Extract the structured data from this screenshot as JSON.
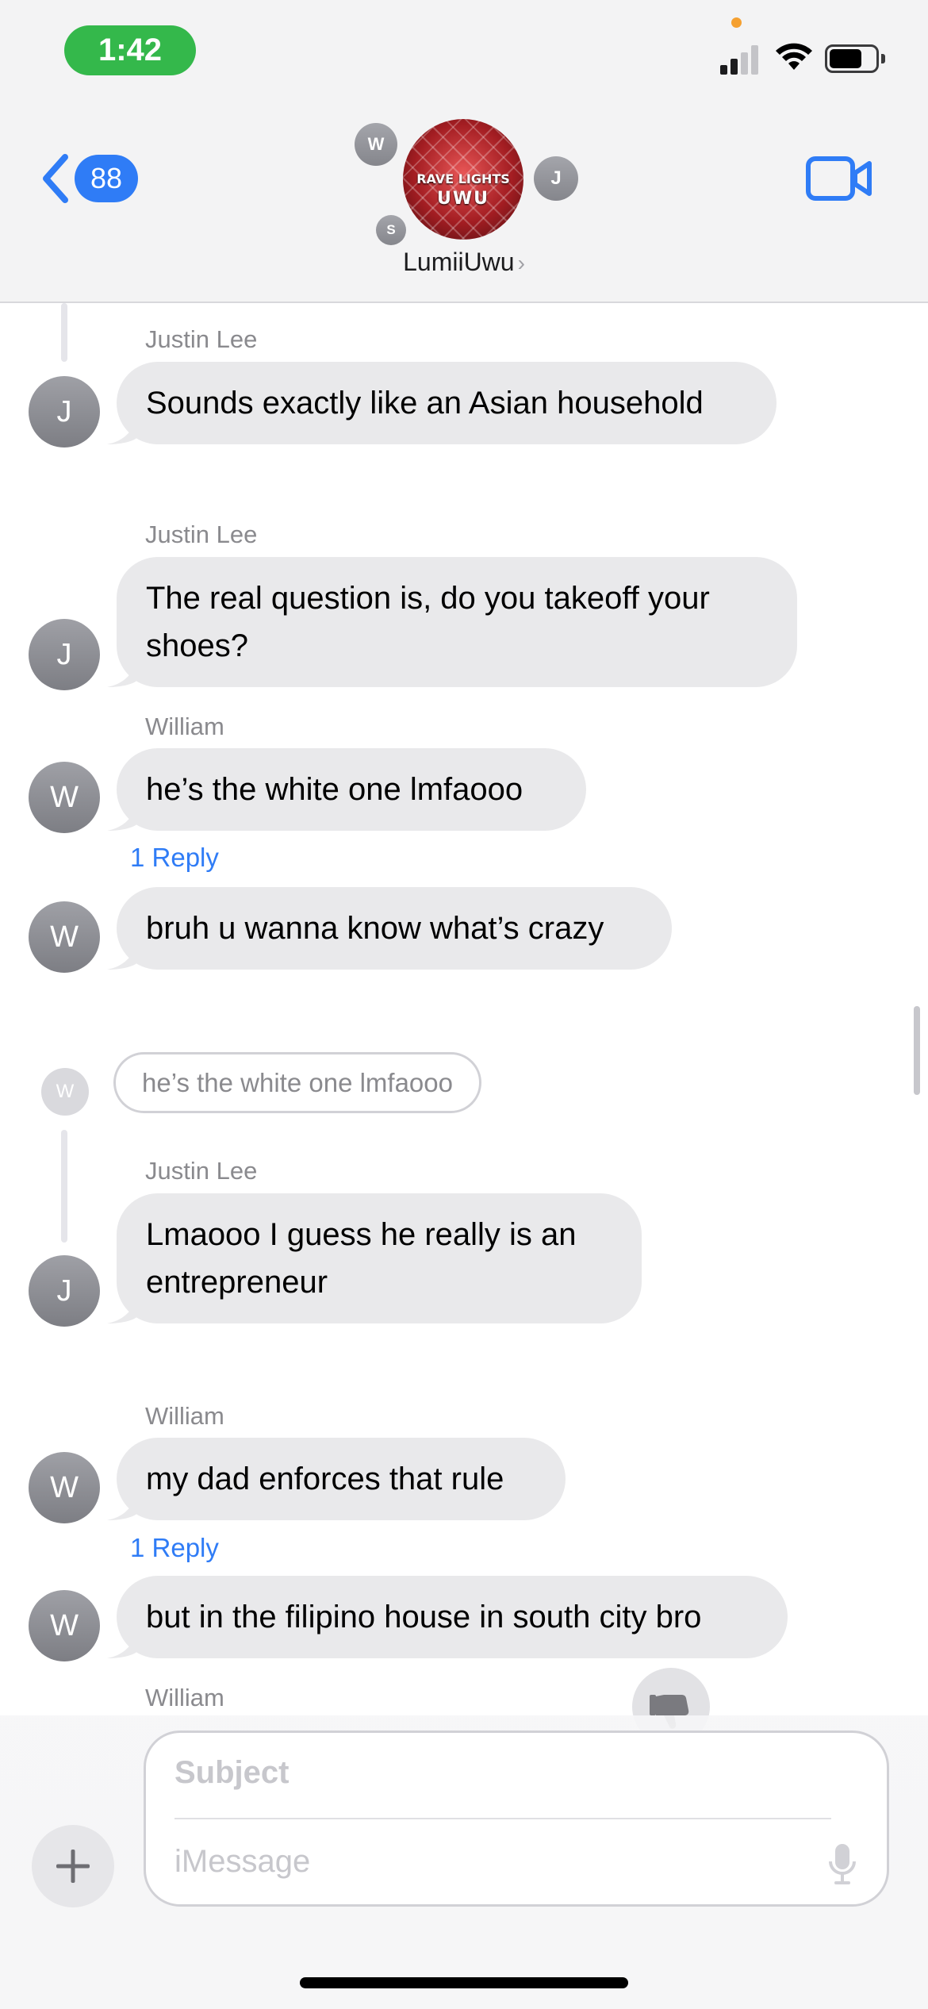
{
  "status_bar": {
    "time": "1:42"
  },
  "header": {
    "back_count": "88",
    "group_name": "LumiiUwu",
    "group_avatar_line1": "RAVE LIGHTS",
    "group_avatar_line2": "UWU",
    "participants": [
      "W",
      "J",
      "S"
    ]
  },
  "messages": [
    {
      "sender": "Justin Lee",
      "initial": "J",
      "text": "Sounds exactly like an Asian household"
    },
    {
      "sender": "Justin Lee",
      "initial": "J",
      "text": "The real question is, do you takeoff your shoes?"
    },
    {
      "sender": "William",
      "initial": "W",
      "text": "he’s the white one lmfaooo",
      "reply_label": "1 Reply"
    },
    {
      "sender": "",
      "initial": "W",
      "text": "bruh u wanna know what’s crazy"
    },
    {
      "quoted_initial": "W",
      "quoted_text": "he’s the white one lmfaooo"
    },
    {
      "sender": "Justin Lee",
      "initial": "J",
      "text": "Lmaooo I guess he really is an entrepreneur"
    },
    {
      "sender": "William",
      "initial": "W",
      "text": "my dad enforces that rule",
      "reply_label": "1 Reply"
    },
    {
      "sender": "",
      "initial": "W",
      "text": "but in the filipino house in south city bro"
    },
    {
      "sender": "William"
    }
  ],
  "composer": {
    "subject_placeholder": "Subject",
    "message_placeholder": "iMessage"
  }
}
